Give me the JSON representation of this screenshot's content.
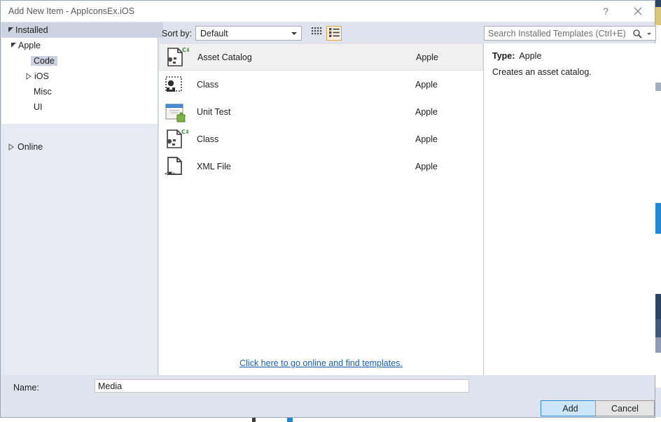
{
  "window": {
    "title": "Add New Item - AppIconsEx.iOS",
    "help_label": "?",
    "close_label": "✕"
  },
  "sidebar": {
    "header": {
      "label": "Installed"
    },
    "groups": [
      {
        "label": "Apple",
        "expanded": true,
        "arrow": "expanded-triangle-icon"
      },
      {
        "label": "Code",
        "selected": true,
        "arrow": ""
      },
      {
        "label": "iOS",
        "expanded": false,
        "arrow": "collapsed-triangle-icon"
      },
      {
        "label": "Misc",
        "arrow": ""
      },
      {
        "label": "UI",
        "arrow": ""
      }
    ],
    "online": {
      "label": "Online",
      "expanded": false,
      "arrow": "collapsed-triangle-icon"
    }
  },
  "toolbar": {
    "sort_label": "Sort by:",
    "sort_value": "Default",
    "sort_options": [
      "Default"
    ],
    "tiles_view_icon": "grid-tiles-icon",
    "list_view_icon": "list-view-icon",
    "list_view_active": true,
    "accent_color": "#e8a33d"
  },
  "search": {
    "placeholder": "Search Installed Templates (Ctrl+E)",
    "value": "",
    "icon": "search-icon",
    "dropdown_icon": "chevron-down-icon"
  },
  "templates": {
    "origin_column_header": "",
    "items": [
      {
        "name": "Asset Catalog",
        "origin": "Apple",
        "icon": "csharp-asset-file-icon",
        "selected": true
      },
      {
        "name": "Class",
        "origin": "Apple",
        "icon": "dotted-class-icon",
        "selected": false
      },
      {
        "name": "Unit Test",
        "origin": "Apple",
        "icon": "unit-test-window-icon",
        "selected": false
      },
      {
        "name": "Class",
        "origin": "Apple",
        "icon": "csharp-asset-file-icon",
        "selected": false
      },
      {
        "name": "XML File",
        "origin": "Apple",
        "icon": "xml-file-icon",
        "selected": false
      }
    ],
    "online_link": "Click here to go online and find templates."
  },
  "details": {
    "type_label": "Type:",
    "type_value": "Apple",
    "description": "Creates an asset catalog."
  },
  "name_field": {
    "label": "Name:",
    "value": "Media",
    "placeholder": ""
  },
  "actions": {
    "add_label": "Add",
    "cancel_label": "Cancel"
  },
  "colors": {
    "dialog_background": "#dfe3ee",
    "tree_header": "#cdd2e0",
    "selection": "#f0f0f0",
    "link": "#1a5fb4",
    "primary_button_fill": "#cbe6fb",
    "primary_button_border": "#2f8ad4"
  }
}
